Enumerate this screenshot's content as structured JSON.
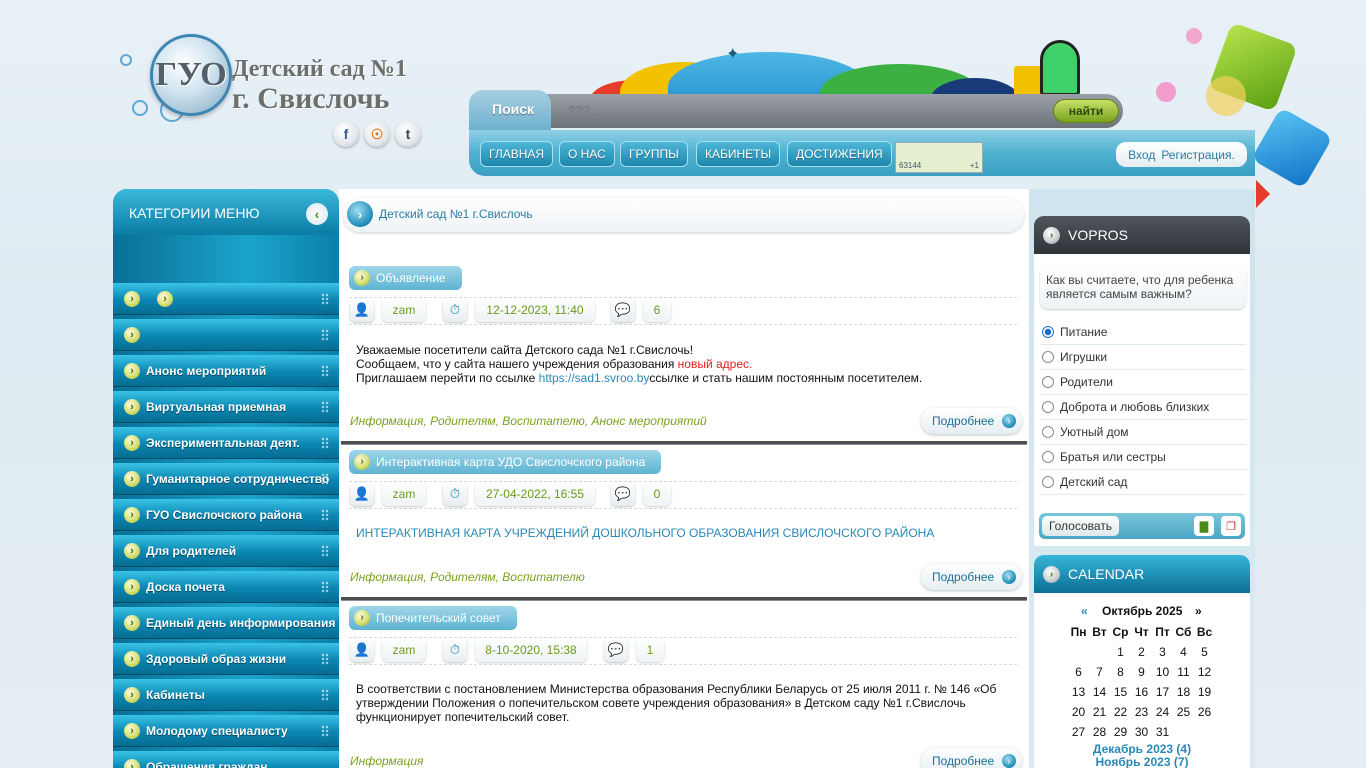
{
  "header": {
    "logo_abbr": "ГУО",
    "title_line1": "Детский сад №1",
    "title_line2": "г. Свислочь",
    "social": [
      "f",
      "rss",
      "t"
    ]
  },
  "search": {
    "label": "Поиск",
    "placeholder": "???...",
    "button": "найти"
  },
  "nav": {
    "items": [
      "ГЛАВНАЯ",
      "О НАС",
      "ГРУППЫ",
      "КАБИНЕТЫ",
      "ДОСТИЖЕНИЯ"
    ],
    "counter_left": "63144",
    "counter_right": "+1",
    "login": "Вход",
    "register": "Регистрация."
  },
  "sidebar": {
    "title": "КАТЕГОРИИ МЕНЮ",
    "items": [
      "Анонс мероприятий",
      "Виртуальная приемная",
      "Экспериментальная деят.",
      "Гуманитарное сотрудничество",
      "ГУО Свислочского района",
      "Для родителей",
      "Доска почета",
      "Единый день информирования",
      "Здоровый образ жизни",
      "Кабинеты",
      "Молодому специалисту",
      "Обращения граждан"
    ]
  },
  "breadcrumb": "Детский сад №1 г.Свислочь",
  "posts": [
    {
      "title": "Объявление",
      "author": "zam",
      "date": "12-12-2023, 11:40",
      "comments": "6",
      "body_line1": "Уважаемые посетители сайта Детского сада №1 г.Свислочь!",
      "body_line2_a": "Сообщаем, что у сайта нашего учреждения образования ",
      "body_line2_b": "новый адрес.",
      "body_line3_a": "Приглашаем перейти по ссылке ",
      "body_line3_link": "https://sad1.svroo.by",
      "body_line3_b": "ссылке и стать нашим постоянным посетителем.",
      "tags": "Информация, Родителям, Воспитателю, Анонс мероприятий",
      "more": "Подробнее"
    },
    {
      "title": "Интерактивная карта УДО Свислочского района",
      "author": "zam",
      "date": "27-04-2022, 16:55",
      "comments": "0",
      "body_link": "ИНТЕРАКТИВНАЯ КАРТА УЧРЕЖДЕНИЙ ДОШКОЛЬНОГО ОБРАЗОВАНИЯ СВИСЛОЧСКОГО РАЙОНА",
      "tags": "Информация, Родителям, Воспитателю",
      "more": "Подробнее"
    },
    {
      "title": "Попечительский совет",
      "author": "zam",
      "date": "8-10-2020, 15:38",
      "comments": "1",
      "body_line1": "В соответствии с постановлением Министерства образования Республики Беларусь от 25 июля 2011 г. № 146 «Об",
      "body_line2": "утверждении Положения о попечительском совете учреждения образования» в Детском саду №1 г.Свислочь",
      "body_line3": "функционирует попечительский совет.",
      "tags": "Информация",
      "more": "Подробнее"
    }
  ],
  "poll": {
    "title": "VOPROS",
    "question": "Как вы считаете, что для ребенка является самым важным?",
    "options": [
      "Питание",
      "Игрушки",
      "Родители",
      "Доброта и любовь близких",
      "Уютный дом",
      "Братья или сестры",
      "Детский сад"
    ],
    "selected_index": 0,
    "vote": "Голосовать"
  },
  "calendar": {
    "title": "CALENDAR",
    "prev": "«",
    "month": "Октябрь 2025",
    "next": "»",
    "weekdays": [
      "Пн",
      "Вт",
      "Ср",
      "Чт",
      "Пт",
      "Сб",
      "Вс"
    ],
    "weeks": [
      [
        "",
        "",
        "1",
        "2",
        "3",
        "4",
        "5"
      ],
      [
        "6",
        "7",
        "8",
        "9",
        "10",
        "11",
        "12"
      ],
      [
        "13",
        "14",
        "15",
        "16",
        "17",
        "18",
        "19"
      ],
      [
        "20",
        "21",
        "22",
        "23",
        "24",
        "25",
        "26"
      ],
      [
        "27",
        "28",
        "29",
        "30",
        "31",
        "",
        ""
      ]
    ],
    "archive": [
      "Декабрь 2023 (4)",
      "Ноябрь 2023 (7)"
    ]
  },
  "colors": {
    "accent_blue": "#1a8ab5",
    "accent_green": "#7aa21f",
    "alert_red": "#e0211f"
  }
}
